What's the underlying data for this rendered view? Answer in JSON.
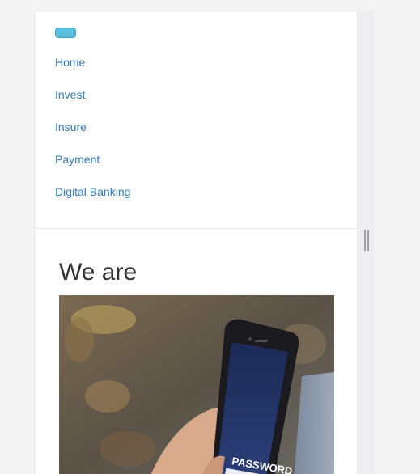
{
  "nav": {
    "toggle_label": "",
    "items": [
      {
        "label": "Home"
      },
      {
        "label": "Invest"
      },
      {
        "label": "Insure"
      },
      {
        "label": "Payment"
      },
      {
        "label": "Digital Banking"
      }
    ]
  },
  "main": {
    "heading": "We are",
    "hero_phone_text": "PASSWORD"
  },
  "colors": {
    "link": "#337ab7",
    "toggle": "#5bc0de",
    "heading": "#333333"
  }
}
